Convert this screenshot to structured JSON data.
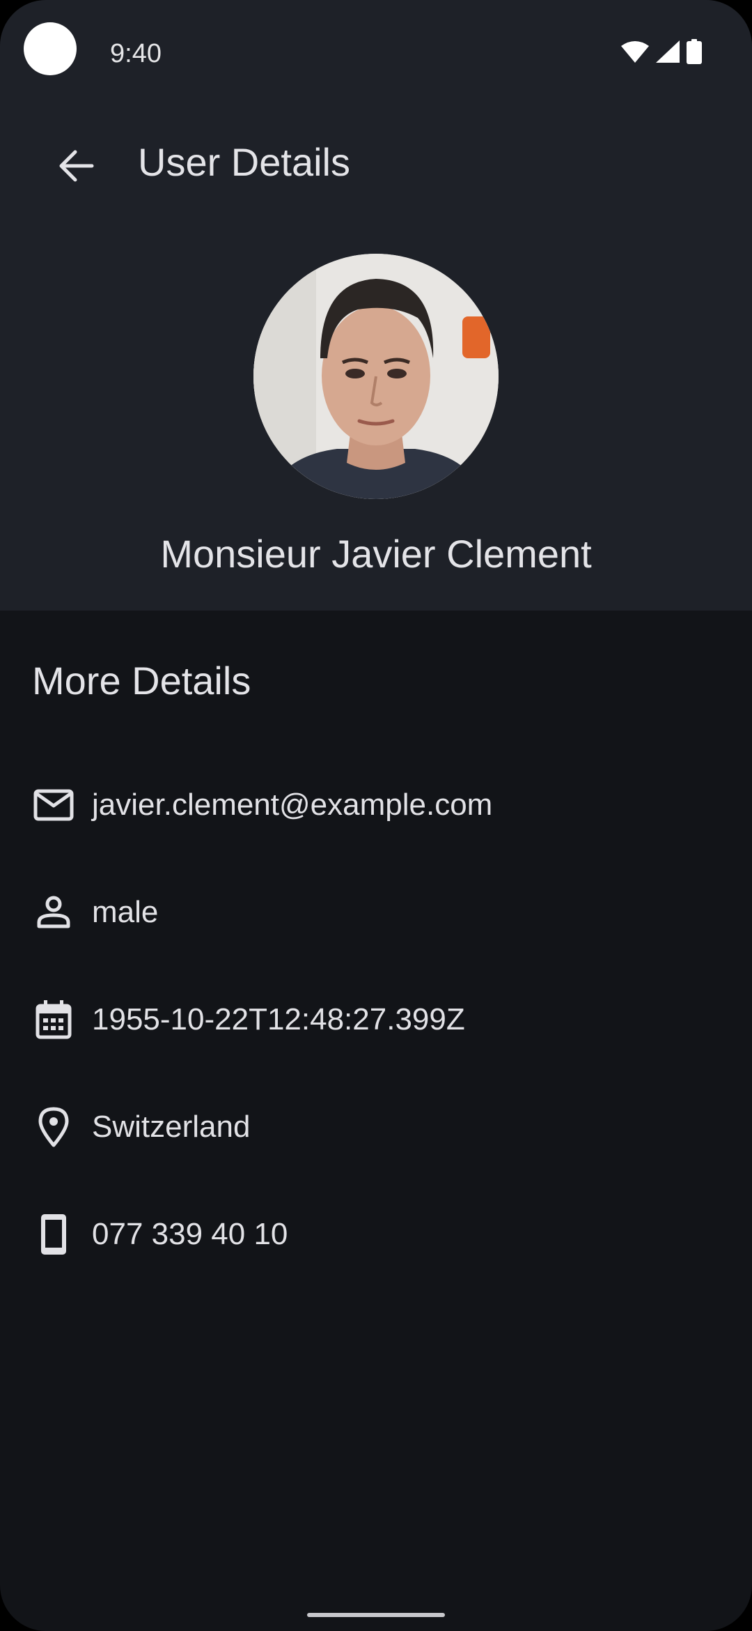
{
  "status_bar": {
    "time": "9:40",
    "icons": [
      "wifi-icon",
      "cellular-signal-icon",
      "battery-icon"
    ]
  },
  "app_bar": {
    "back_icon": "arrow-back-icon",
    "title": "User Details"
  },
  "profile": {
    "name": "Monsieur Javier Clement"
  },
  "more_details": {
    "title": "More Details",
    "items": [
      {
        "icon": "email-icon",
        "value": "javier.clement@example.com"
      },
      {
        "icon": "person-icon",
        "value": "male"
      },
      {
        "icon": "calendar-icon",
        "value": "1955-10-22T12:48:27.399Z"
      },
      {
        "icon": "location-pin-icon",
        "value": "Switzerland"
      },
      {
        "icon": "phone-icon",
        "value": "077 339 40 10"
      }
    ]
  },
  "colors": {
    "header_background": "#1e2128",
    "body_background": "#121418",
    "text": "#e4e4e8"
  }
}
